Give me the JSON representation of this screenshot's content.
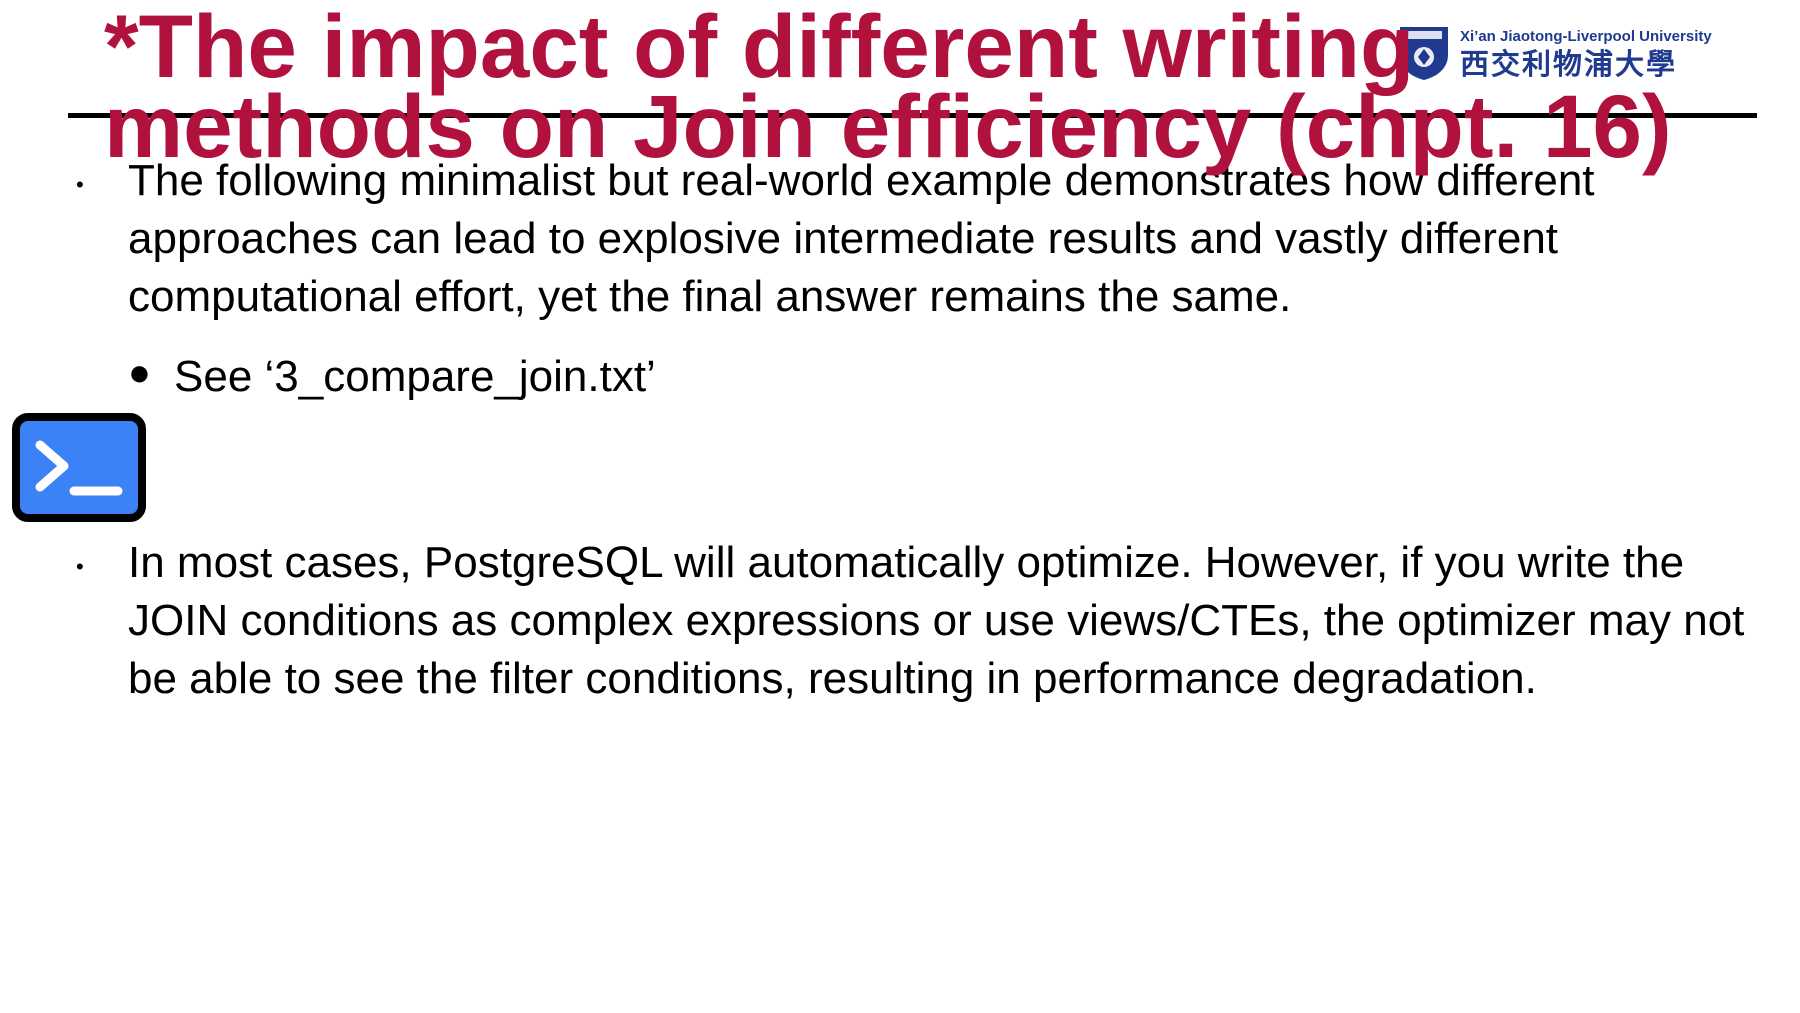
{
  "slide": {
    "title": "*The impact of different writing methods on Join efficiency (chpt. 16)"
  },
  "logo": {
    "english_name": "Xi’an Jiaotong-Liverpool University",
    "chinese_name": "西交利物浦大學",
    "crest_icon": "university-crest-icon",
    "color": "#1f3a8f"
  },
  "content": {
    "bullet1": "The following minimalist but real-world example demonstrates how different approaches can lead to explosive intermediate results and vastly different computational effort, yet the final answer remains the same.",
    "sub_bullet": "See ‘3_compare_join.txt’",
    "bullet2": "In most cases, PostgreSQL will automatically optimize. However, if you write the JOIN conditions as complex expressions or use views/CTEs, the optimizer may not be able to see the filter conditions, resulting in performance degradation."
  },
  "icons": {
    "terminal": "terminal-icon"
  },
  "colors": {
    "title": "#b0123d",
    "text": "#000000",
    "rule": "#000000",
    "terminal_fill": "#3b82f6",
    "terminal_border": "#000000"
  }
}
